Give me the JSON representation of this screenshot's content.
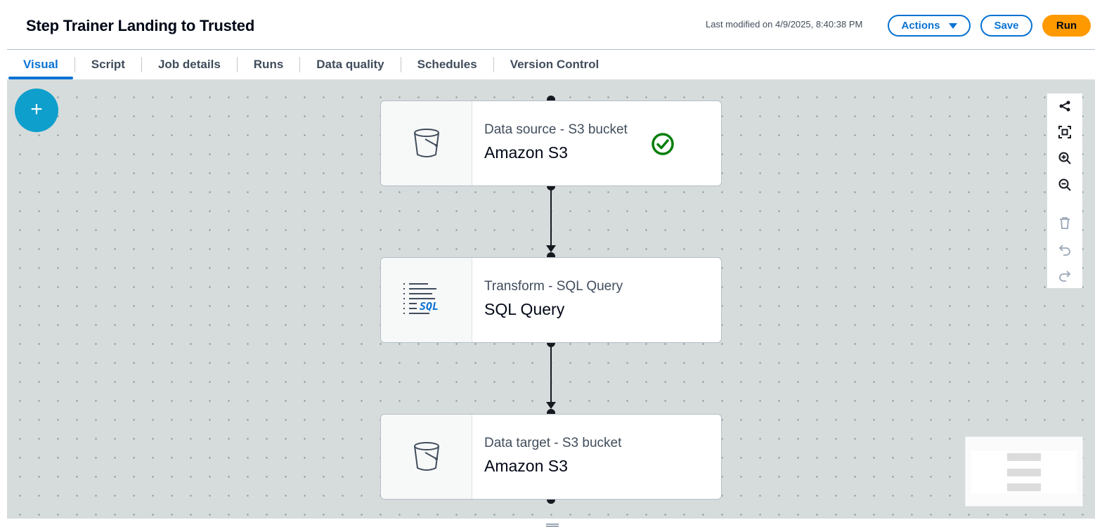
{
  "header": {
    "title": "Step Trainer Landing to Trusted",
    "last_modified": "Last modified on 4/9/2025, 8:40:38 PM",
    "actions_label": "Actions",
    "save_label": "Save",
    "run_label": "Run",
    "colors": {
      "primary": "#0972d3",
      "run": "#ff9900"
    }
  },
  "tabs": [
    {
      "label": "Visual",
      "active": true
    },
    {
      "label": "Script"
    },
    {
      "label": "Job details"
    },
    {
      "label": "Runs"
    },
    {
      "label": "Data quality"
    },
    {
      "label": "Schedules"
    },
    {
      "label": "Version Control"
    }
  ],
  "canvas": {
    "add_button": {
      "icon": "plus-icon",
      "label": "+"
    },
    "nodes": [
      {
        "kind": "Data source - S3 bucket",
        "name": "Amazon S3",
        "icon": "s3-bucket-icon",
        "status": "success",
        "status_icon": "check-circle-icon"
      },
      {
        "kind": "Transform - SQL Query",
        "name": "SQL Query",
        "icon": "sql-query-icon",
        "icon_text": "SQL"
      },
      {
        "kind": "Data target - S3 bucket",
        "name": "Amazon S3",
        "icon": "s3-bucket-icon"
      }
    ],
    "toolbar": [
      "layout-icon",
      "fit-to-screen-icon",
      "zoom-in-icon",
      "zoom-out-icon",
      "delete-icon",
      "undo-icon",
      "redo-icon"
    ],
    "status_color": "#037f0c"
  }
}
